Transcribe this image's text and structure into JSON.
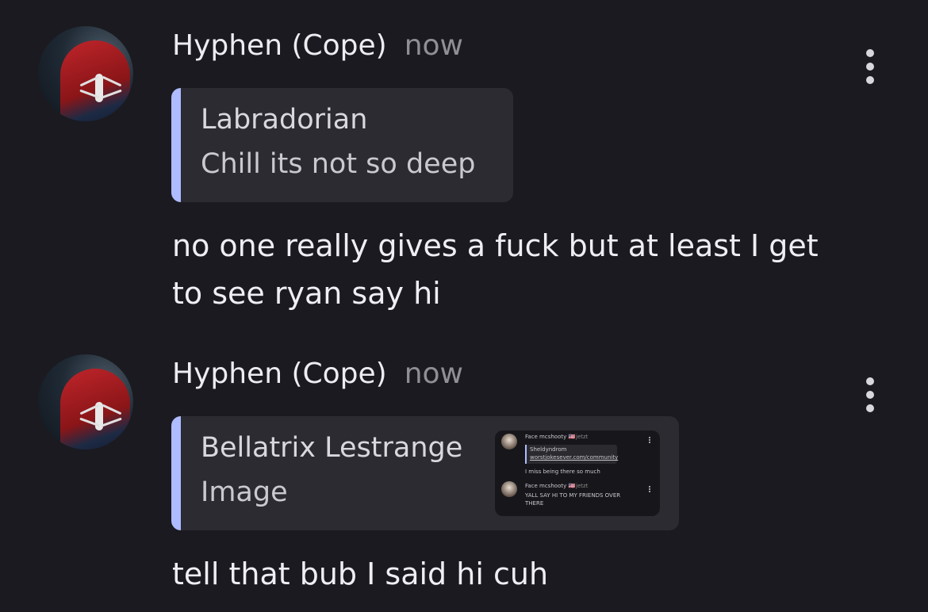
{
  "messages": [
    {
      "author": "Hyphen (Cope)",
      "time": "now",
      "avatar_icon": "spiderman-avatar",
      "reply": {
        "author": "Labradorian",
        "text": "Chill its not so deep"
      },
      "text": "no one really gives a fuck but at least I get to see ryan say hi"
    },
    {
      "author": "Hyphen (Cope)",
      "time": "now",
      "avatar_icon": "spiderman-avatar",
      "reply": {
        "author": "Bellatrix Lestrange",
        "text": "Image",
        "thumbnail": {
          "msg1_author": "Face mcshooty 🇺🇸",
          "msg1_time": "jetzt",
          "msg1_quote_author": "Sheldyndrom",
          "msg1_quote_link": "worstjokesever.com/community",
          "msg1_text": "I miss being there so much",
          "msg2_author": "Face mcshooty 🇺🇸",
          "msg2_time": "jetzt",
          "msg2_text": "YALL SAY HI TO MY FRIENDS OVER",
          "msg2_text2": "THERE"
        }
      },
      "text": "tell that bub I said hi cuh"
    }
  ],
  "colors": {
    "background": "#1a1a20",
    "quote_accent": "#aebbff",
    "quote_bg": "#2b2b31"
  }
}
